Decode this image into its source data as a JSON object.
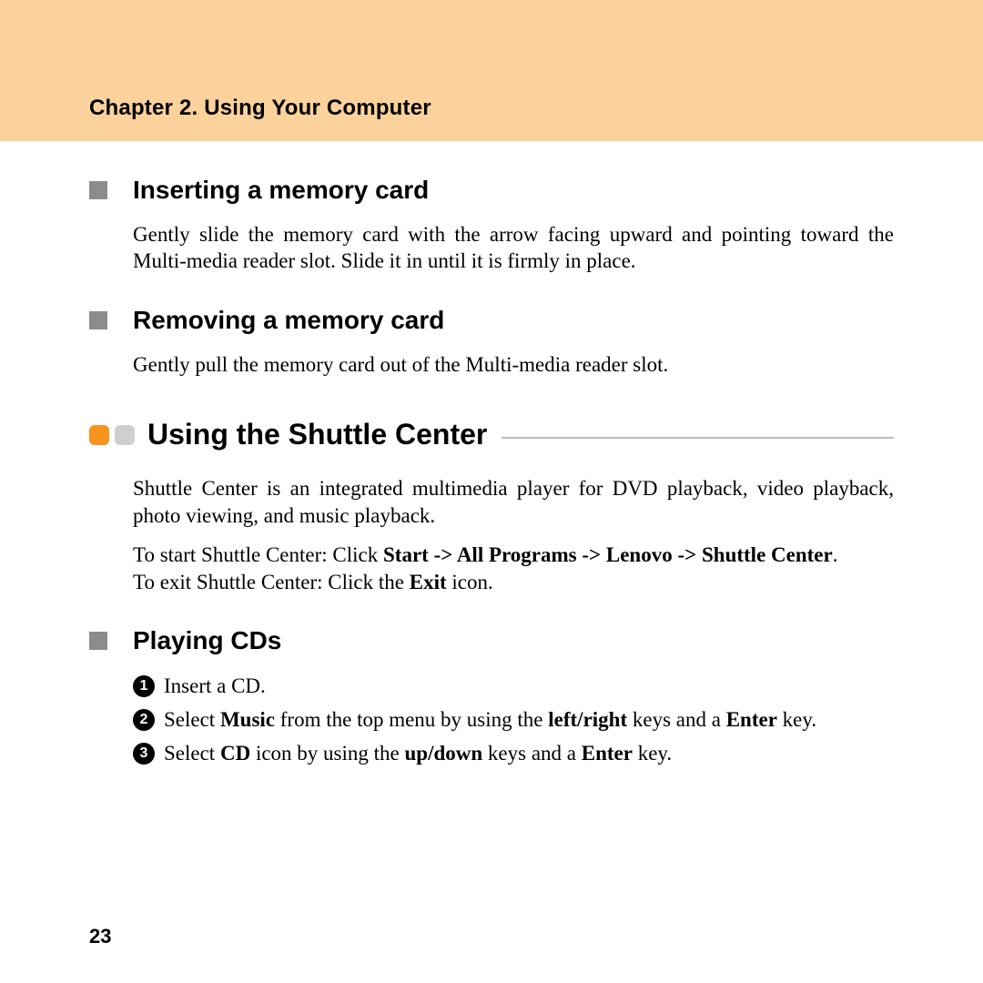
{
  "header": {
    "chapter_title": "Chapter 2. Using Your Computer"
  },
  "sections": {
    "insert": {
      "title": "Inserting a memory card",
      "body": "Gently slide the memory card with the arrow facing upward and pointing toward the Multi-media reader slot. Slide it in until it is firmly in place."
    },
    "remove": {
      "title": "Removing a memory card",
      "body": "Gently pull the memory card out of the Multi-media reader slot."
    },
    "shuttle": {
      "title": "Using the Shuttle Center",
      "intro": "Shuttle Center is an integrated multimedia player for DVD playback, video playback, photo viewing, and music playback.",
      "start_prefix": "To start Shuttle Center: Click ",
      "start_bold": "Start -> All Programs -> Lenovo -> Shuttle Center",
      "start_suffix": ".",
      "exit_prefix": "To exit Shuttle Center: Click the ",
      "exit_bold": "Exit",
      "exit_suffix": " icon."
    },
    "playing": {
      "title": "Playing CDs",
      "steps": {
        "s1": "Insert a CD.",
        "s2_a": "Select ",
        "s2_b": "Music",
        "s2_c": " from the top menu by using the ",
        "s2_d": "left/right",
        "s2_e": " keys and a ",
        "s2_f": "Enter",
        "s2_g": " key.",
        "s3_a": "Select ",
        "s3_b": "CD",
        "s3_c": " icon by using the ",
        "s3_d": "up/down",
        "s3_e": " keys and a ",
        "s3_f": "Enter",
        "s3_g": " key."
      }
    }
  },
  "page_number": "23"
}
